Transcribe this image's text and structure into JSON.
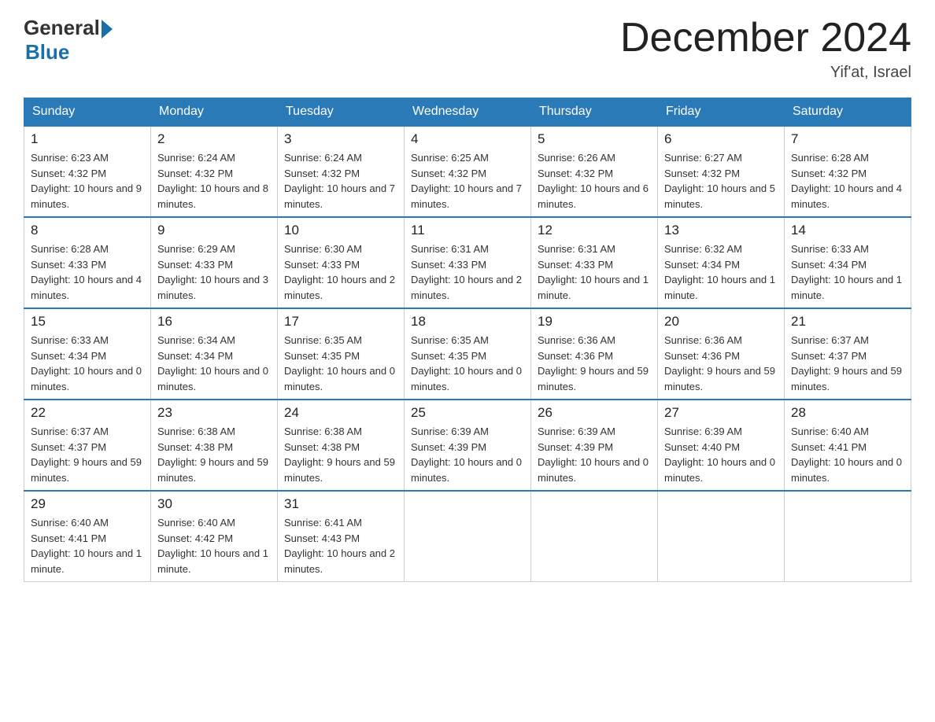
{
  "logo": {
    "general": "General",
    "blue": "Blue"
  },
  "title": "December 2024",
  "location": "Yif'at, Israel",
  "days_of_week": [
    "Sunday",
    "Monday",
    "Tuesday",
    "Wednesday",
    "Thursday",
    "Friday",
    "Saturday"
  ],
  "weeks": [
    [
      {
        "day": "1",
        "sunrise": "6:23 AM",
        "sunset": "4:32 PM",
        "daylight": "10 hours and 9 minutes."
      },
      {
        "day": "2",
        "sunrise": "6:24 AM",
        "sunset": "4:32 PM",
        "daylight": "10 hours and 8 minutes."
      },
      {
        "day": "3",
        "sunrise": "6:24 AM",
        "sunset": "4:32 PM",
        "daylight": "10 hours and 7 minutes."
      },
      {
        "day": "4",
        "sunrise": "6:25 AM",
        "sunset": "4:32 PM",
        "daylight": "10 hours and 7 minutes."
      },
      {
        "day": "5",
        "sunrise": "6:26 AM",
        "sunset": "4:32 PM",
        "daylight": "10 hours and 6 minutes."
      },
      {
        "day": "6",
        "sunrise": "6:27 AM",
        "sunset": "4:32 PM",
        "daylight": "10 hours and 5 minutes."
      },
      {
        "day": "7",
        "sunrise": "6:28 AM",
        "sunset": "4:32 PM",
        "daylight": "10 hours and 4 minutes."
      }
    ],
    [
      {
        "day": "8",
        "sunrise": "6:28 AM",
        "sunset": "4:33 PM",
        "daylight": "10 hours and 4 minutes."
      },
      {
        "day": "9",
        "sunrise": "6:29 AM",
        "sunset": "4:33 PM",
        "daylight": "10 hours and 3 minutes."
      },
      {
        "day": "10",
        "sunrise": "6:30 AM",
        "sunset": "4:33 PM",
        "daylight": "10 hours and 2 minutes."
      },
      {
        "day": "11",
        "sunrise": "6:31 AM",
        "sunset": "4:33 PM",
        "daylight": "10 hours and 2 minutes."
      },
      {
        "day": "12",
        "sunrise": "6:31 AM",
        "sunset": "4:33 PM",
        "daylight": "10 hours and 1 minute."
      },
      {
        "day": "13",
        "sunrise": "6:32 AM",
        "sunset": "4:34 PM",
        "daylight": "10 hours and 1 minute."
      },
      {
        "day": "14",
        "sunrise": "6:33 AM",
        "sunset": "4:34 PM",
        "daylight": "10 hours and 1 minute."
      }
    ],
    [
      {
        "day": "15",
        "sunrise": "6:33 AM",
        "sunset": "4:34 PM",
        "daylight": "10 hours and 0 minutes."
      },
      {
        "day": "16",
        "sunrise": "6:34 AM",
        "sunset": "4:34 PM",
        "daylight": "10 hours and 0 minutes."
      },
      {
        "day": "17",
        "sunrise": "6:35 AM",
        "sunset": "4:35 PM",
        "daylight": "10 hours and 0 minutes."
      },
      {
        "day": "18",
        "sunrise": "6:35 AM",
        "sunset": "4:35 PM",
        "daylight": "10 hours and 0 minutes."
      },
      {
        "day": "19",
        "sunrise": "6:36 AM",
        "sunset": "4:36 PM",
        "daylight": "9 hours and 59 minutes."
      },
      {
        "day": "20",
        "sunrise": "6:36 AM",
        "sunset": "4:36 PM",
        "daylight": "9 hours and 59 minutes."
      },
      {
        "day": "21",
        "sunrise": "6:37 AM",
        "sunset": "4:37 PM",
        "daylight": "9 hours and 59 minutes."
      }
    ],
    [
      {
        "day": "22",
        "sunrise": "6:37 AM",
        "sunset": "4:37 PM",
        "daylight": "9 hours and 59 minutes."
      },
      {
        "day": "23",
        "sunrise": "6:38 AM",
        "sunset": "4:38 PM",
        "daylight": "9 hours and 59 minutes."
      },
      {
        "day": "24",
        "sunrise": "6:38 AM",
        "sunset": "4:38 PM",
        "daylight": "9 hours and 59 minutes."
      },
      {
        "day": "25",
        "sunrise": "6:39 AM",
        "sunset": "4:39 PM",
        "daylight": "10 hours and 0 minutes."
      },
      {
        "day": "26",
        "sunrise": "6:39 AM",
        "sunset": "4:39 PM",
        "daylight": "10 hours and 0 minutes."
      },
      {
        "day": "27",
        "sunrise": "6:39 AM",
        "sunset": "4:40 PM",
        "daylight": "10 hours and 0 minutes."
      },
      {
        "day": "28",
        "sunrise": "6:40 AM",
        "sunset": "4:41 PM",
        "daylight": "10 hours and 0 minutes."
      }
    ],
    [
      {
        "day": "29",
        "sunrise": "6:40 AM",
        "sunset": "4:41 PM",
        "daylight": "10 hours and 1 minute."
      },
      {
        "day": "30",
        "sunrise": "6:40 AM",
        "sunset": "4:42 PM",
        "daylight": "10 hours and 1 minute."
      },
      {
        "day": "31",
        "sunrise": "6:41 AM",
        "sunset": "4:43 PM",
        "daylight": "10 hours and 2 minutes."
      },
      null,
      null,
      null,
      null
    ]
  ]
}
